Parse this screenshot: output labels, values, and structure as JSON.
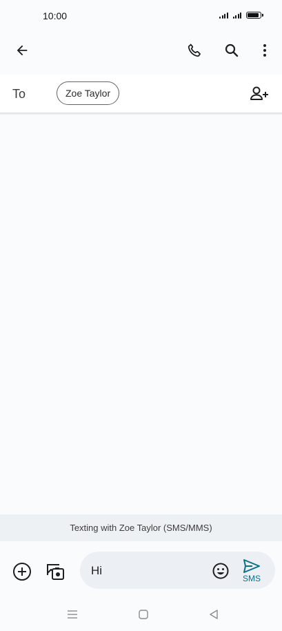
{
  "status_bar": {
    "time": "10:00"
  },
  "compose": {
    "to_label": "To",
    "recipient": "Zoe Taylor"
  },
  "banner": {
    "text": "Texting with Zoe Taylor (SMS/MMS)"
  },
  "composer": {
    "input_value": "Hi",
    "send_label": "SMS"
  },
  "colors": {
    "accent": "#0b6f8c",
    "banner_bg": "#eef1f4",
    "input_bg": "#eceff3"
  },
  "icons": [
    "back-arrow-icon",
    "phone-icon",
    "search-icon",
    "more-vert-icon",
    "add-person-icon",
    "add-circle-icon",
    "gallery-icon",
    "emoji-icon",
    "send-icon",
    "nav-menu-icon",
    "nav-home-icon",
    "nav-back-icon"
  ]
}
